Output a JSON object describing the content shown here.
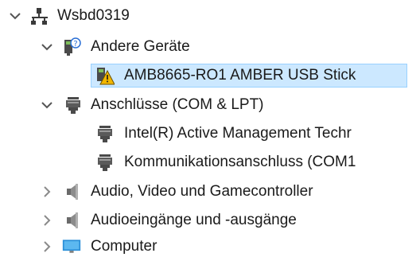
{
  "tree": {
    "root": {
      "label": "Wsbd0319",
      "icon": "computer-network-icon",
      "state": "expanded"
    },
    "items": [
      {
        "label": "Andere Geräte",
        "icon": "unknown-device-icon",
        "state": "expanded",
        "level": 1
      },
      {
        "label": "AMB8665-RO1 AMBER USB Stick",
        "icon": "warning-device-icon",
        "state": "leaf",
        "level": 2,
        "selected": true
      },
      {
        "label": "Anschlüsse (COM & LPT)",
        "icon": "port-connector-icon",
        "state": "expanded",
        "level": 1
      },
      {
        "label": "Intel(R) Active Management Techr",
        "icon": "port-connector-icon",
        "state": "leaf",
        "level": 2
      },
      {
        "label": "Kommunikationsanschluss (COM1",
        "icon": "port-connector-icon",
        "state": "leaf",
        "level": 2
      },
      {
        "label": "Audio, Video und Gamecontroller",
        "icon": "speaker-icon",
        "state": "collapsed",
        "level": 1
      },
      {
        "label": "Audioeingänge und -ausgänge",
        "icon": "speaker-icon",
        "state": "collapsed",
        "level": 1
      },
      {
        "label": "Computer",
        "icon": "monitor-icon",
        "state": "collapsed",
        "level": 1
      }
    ]
  },
  "colors": {
    "selection_bg": "#cce8ff",
    "selection_border": "#99d1ff",
    "chevron": "#555555",
    "warning": "#f2b600"
  }
}
